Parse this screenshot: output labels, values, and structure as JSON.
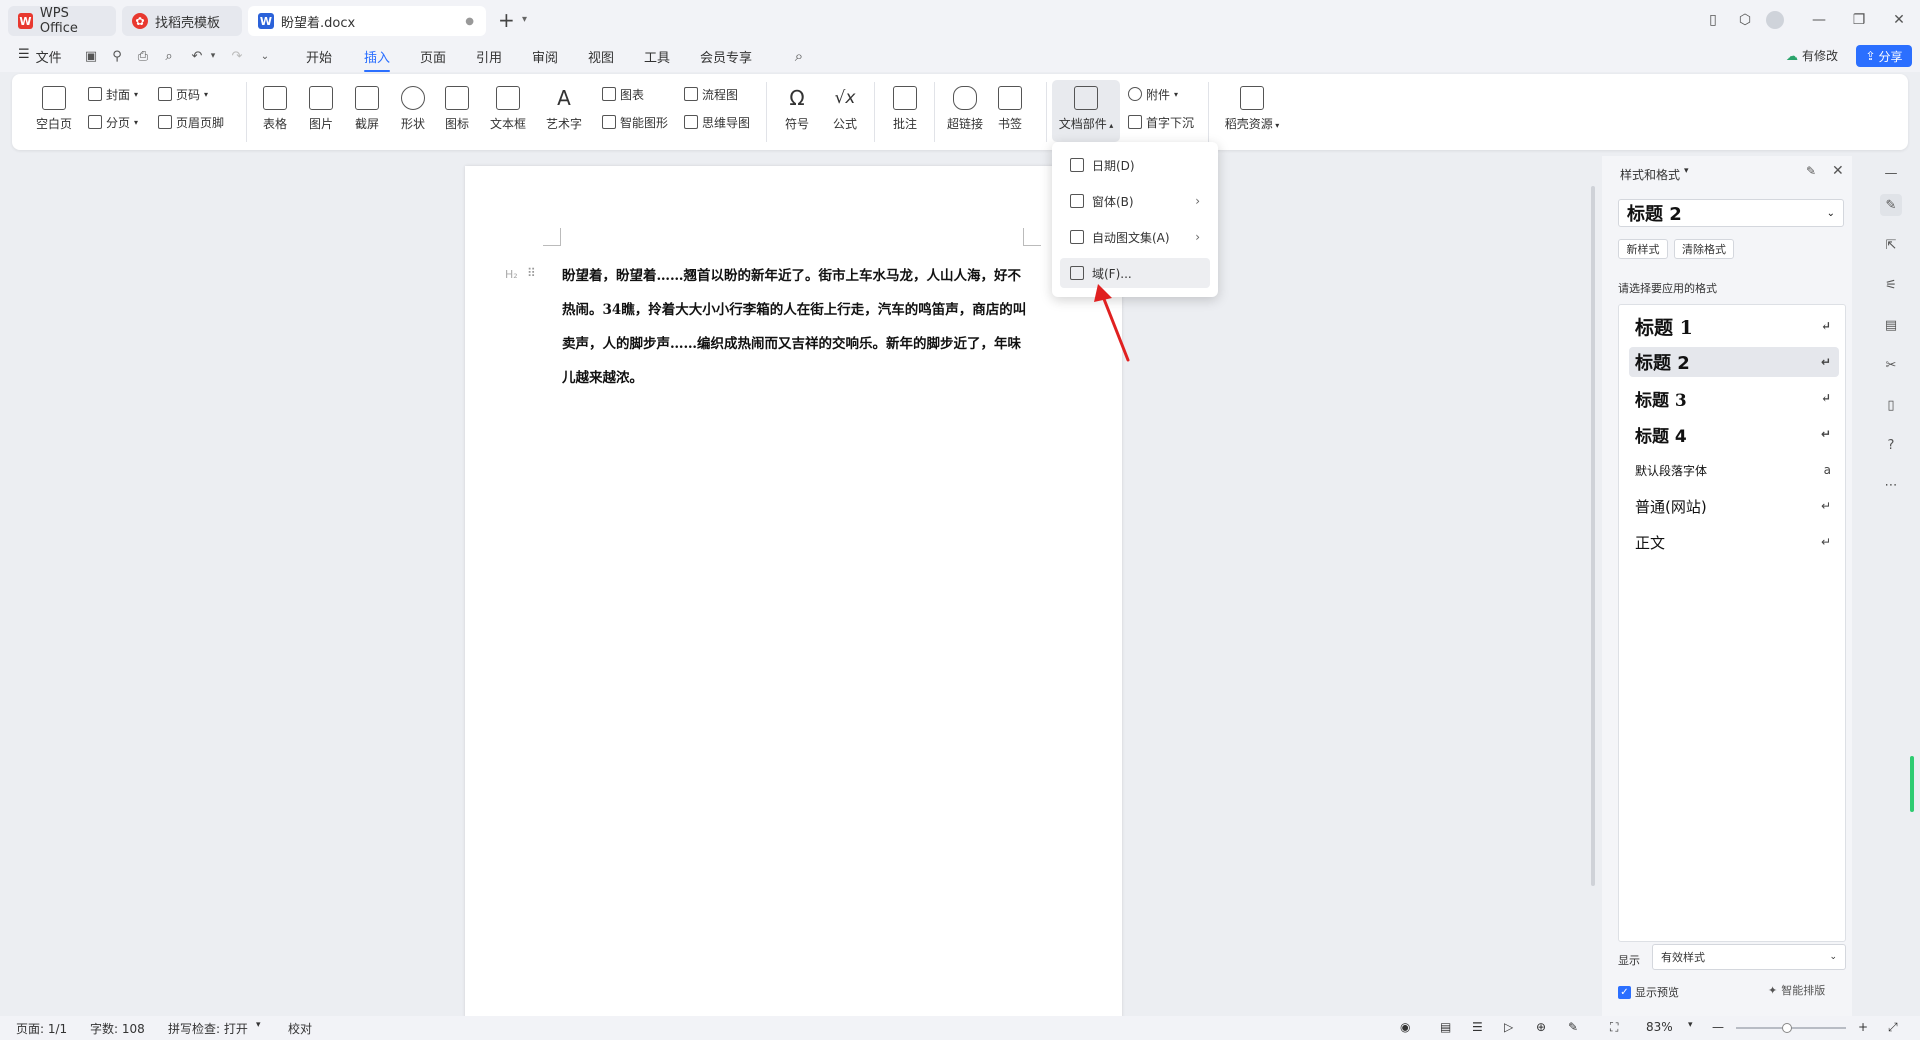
{
  "titlebar": {
    "tabs": [
      {
        "label": "WPS Office"
      },
      {
        "label": "找稻壳模板"
      },
      {
        "label": "盼望着.docx"
      }
    ],
    "new_tab": "+"
  },
  "menubar": {
    "file_label": "文件",
    "items": [
      "开始",
      "插入",
      "页面",
      "引用",
      "审阅",
      "视图",
      "工具",
      "会员专享"
    ],
    "active_item": "插入",
    "modify_label": "有修改",
    "share_label": "分享"
  },
  "ribbon": {
    "blank_page": "空白页",
    "cover": "封面",
    "page_break": "分页",
    "page_number": "页码",
    "header_footer": "页眉页脚",
    "table": "表格",
    "picture": "图片",
    "screenshot": "截屏",
    "shape": "形状",
    "icon": "图标",
    "textbox": "文本框",
    "wordart": "艺术字",
    "chart": "图表",
    "smartart": "智能图形",
    "flowchart": "流程图",
    "mindmap": "思维导图",
    "symbol": "符号",
    "formula": "公式",
    "comment": "批注",
    "hyperlink": "超链接",
    "bookmark": "书签",
    "doc_parts": "文档部件",
    "attachment": "附件",
    "dropcap": "首字下沉",
    "resources": "稻壳资源"
  },
  "dropdown": {
    "items": [
      {
        "label": "日期(D)",
        "submenu": false
      },
      {
        "label": "窗体(B)",
        "submenu": true
      },
      {
        "label": "自动图文集(A)",
        "submenu": true
      },
      {
        "label": "域(F)...",
        "submenu": false
      }
    ]
  },
  "document": {
    "heading_marker": "H₂",
    "paragraph": "盼望着，盼望着……翘首以盼的新年近了。街市上车水马龙，人山人海，好不热闹。34瞧，拎着大大小小行李箱的人在街上行走，汽车的鸣笛声，商店的叫卖声，人的脚步声……编织成热闹而又吉祥的交响乐。新年的脚步近了，年味儿越来越浓。"
  },
  "panel": {
    "title": "样式和格式",
    "current_style": "标题 2",
    "new_style": "新样式",
    "clear_format": "清除格式",
    "prompt": "请选择要应用的格式",
    "styles": [
      {
        "label": "标题 1",
        "mark": "↵"
      },
      {
        "label": "标题 2",
        "mark": "↵"
      },
      {
        "label": "标题 3",
        "mark": "↵"
      },
      {
        "label": "标题 4",
        "mark": "↵"
      },
      {
        "label": "默认段落字体",
        "mark": "a"
      },
      {
        "label": "普通(网站)",
        "mark": "↵"
      },
      {
        "label": "正文",
        "mark": "↵"
      }
    ],
    "show_label": "显示",
    "show_value": "有效样式",
    "preview_label": "显示预览",
    "smart_layout": "智能排版"
  },
  "statusbar": {
    "page": "页面: 1/1",
    "words": "字数: 108",
    "spell": "拼写检查: 打开",
    "proof": "校对",
    "zoom": "83%"
  },
  "colors": {
    "accent": "#2b6fff",
    "wps_red": "#e8382f",
    "word_blue": "#2b62d9",
    "arrow_red": "#e02020"
  }
}
